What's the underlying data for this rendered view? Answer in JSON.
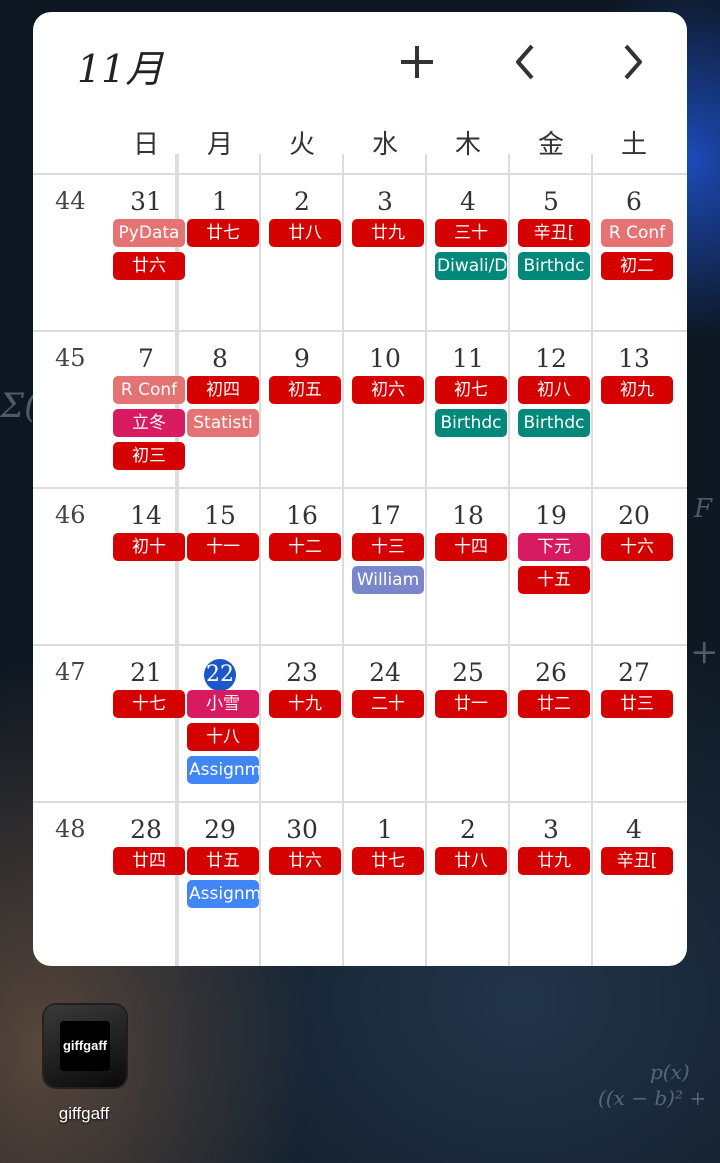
{
  "header": {
    "month": "11月"
  },
  "icons": {
    "add": "plus-icon",
    "prev": "chevron-left-icon",
    "next": "chevron-right-icon"
  },
  "colors": {
    "holiday_red": "#d50000",
    "solar_term_pink": "#d81b60",
    "salmon": "#e57373",
    "teal": "#00897b",
    "lavender": "#7986cb",
    "blue": "#4285f4",
    "today": "#1a57c8"
  },
  "weekdays": [
    "日",
    "月",
    "火",
    "水",
    "木",
    "金",
    "土"
  ],
  "weeks": [
    {
      "num": "44",
      "days": [
        {
          "d": "31",
          "chips": [
            {
              "t": "PyData",
              "c": "#e57373"
            },
            {
              "t": "廿六",
              "c": "#d50000"
            }
          ]
        },
        {
          "d": "1",
          "chips": [
            {
              "t": "廿七",
              "c": "#d50000"
            }
          ]
        },
        {
          "d": "2",
          "chips": [
            {
              "t": "廿八",
              "c": "#d50000"
            }
          ]
        },
        {
          "d": "3",
          "chips": [
            {
              "t": "廿九",
              "c": "#d50000"
            }
          ]
        },
        {
          "d": "4",
          "chips": [
            {
              "t": "三十",
              "c": "#d50000"
            },
            {
              "t": "Diwali/D",
              "c": "#00897b"
            }
          ]
        },
        {
          "d": "5",
          "chips": [
            {
              "t": "辛丑[",
              "c": "#d50000"
            },
            {
              "t": "Birthdc",
              "c": "#00897b"
            }
          ]
        },
        {
          "d": "6",
          "chips": [
            {
              "t": "R Conf",
              "c": "#e57373"
            },
            {
              "t": "初二",
              "c": "#d50000"
            }
          ]
        }
      ]
    },
    {
      "num": "45",
      "days": [
        {
          "d": "7",
          "chips": [
            {
              "t": "R Conf",
              "c": "#e57373"
            },
            {
              "t": "立冬",
              "c": "#d81b60"
            },
            {
              "t": "初三",
              "c": "#d50000"
            }
          ]
        },
        {
          "d": "8",
          "chips": [
            {
              "t": "初四",
              "c": "#d50000"
            },
            {
              "t": "Statisti",
              "c": "#e57373"
            }
          ]
        },
        {
          "d": "9",
          "chips": [
            {
              "t": "初五",
              "c": "#d50000"
            }
          ]
        },
        {
          "d": "10",
          "chips": [
            {
              "t": "初六",
              "c": "#d50000"
            }
          ]
        },
        {
          "d": "11",
          "chips": [
            {
              "t": "初七",
              "c": "#d50000"
            },
            {
              "t": "Birthdc",
              "c": "#00897b"
            }
          ]
        },
        {
          "d": "12",
          "chips": [
            {
              "t": "初八",
              "c": "#d50000"
            },
            {
              "t": "Birthdc",
              "c": "#00897b"
            }
          ]
        },
        {
          "d": "13",
          "chips": [
            {
              "t": "初九",
              "c": "#d50000"
            }
          ]
        }
      ]
    },
    {
      "num": "46",
      "days": [
        {
          "d": "14",
          "chips": [
            {
              "t": "初十",
              "c": "#d50000"
            }
          ]
        },
        {
          "d": "15",
          "chips": [
            {
              "t": "十一",
              "c": "#d50000"
            }
          ]
        },
        {
          "d": "16",
          "chips": [
            {
              "t": "十二",
              "c": "#d50000"
            }
          ]
        },
        {
          "d": "17",
          "chips": [
            {
              "t": "十三",
              "c": "#d50000"
            },
            {
              "t": "William",
              "c": "#7986cb"
            }
          ]
        },
        {
          "d": "18",
          "chips": [
            {
              "t": "十四",
              "c": "#d50000"
            }
          ]
        },
        {
          "d": "19",
          "chips": [
            {
              "t": "下元",
              "c": "#d81b60"
            },
            {
              "t": "十五",
              "c": "#d50000"
            }
          ]
        },
        {
          "d": "20",
          "chips": [
            {
              "t": "十六",
              "c": "#d50000"
            }
          ]
        }
      ]
    },
    {
      "num": "47",
      "days": [
        {
          "d": "21",
          "chips": [
            {
              "t": "十七",
              "c": "#d50000"
            }
          ]
        },
        {
          "d": "22",
          "today": true,
          "chips": [
            {
              "t": "小雪",
              "c": "#d81b60"
            },
            {
              "t": "十八",
              "c": "#d50000"
            },
            {
              "t": "Assignm",
              "c": "#4285f4"
            }
          ]
        },
        {
          "d": "23",
          "chips": [
            {
              "t": "十九",
              "c": "#d50000"
            }
          ]
        },
        {
          "d": "24",
          "chips": [
            {
              "t": "二十",
              "c": "#d50000"
            }
          ]
        },
        {
          "d": "25",
          "chips": [
            {
              "t": "廿一",
              "c": "#d50000"
            }
          ]
        },
        {
          "d": "26",
          "chips": [
            {
              "t": "廿二",
              "c": "#d50000"
            }
          ]
        },
        {
          "d": "27",
          "chips": [
            {
              "t": "廿三",
              "c": "#d50000"
            }
          ]
        }
      ]
    },
    {
      "num": "48",
      "days": [
        {
          "d": "28",
          "chips": [
            {
              "t": "廿四",
              "c": "#d50000"
            }
          ]
        },
        {
          "d": "29",
          "chips": [
            {
              "t": "廿五",
              "c": "#d50000"
            },
            {
              "t": "Assignm",
              "c": "#4285f4"
            }
          ]
        },
        {
          "d": "30",
          "chips": [
            {
              "t": "廿六",
              "c": "#d50000"
            }
          ]
        },
        {
          "d": "1",
          "chips": [
            {
              "t": "廿七",
              "c": "#d50000"
            }
          ]
        },
        {
          "d": "2",
          "chips": [
            {
              "t": "廿八",
              "c": "#d50000"
            }
          ]
        },
        {
          "d": "3",
          "chips": [
            {
              "t": "廿九",
              "c": "#d50000"
            }
          ]
        },
        {
          "d": "4",
          "chips": [
            {
              "t": "辛丑[",
              "c": "#d50000"
            }
          ]
        }
      ]
    }
  ],
  "app": {
    "icon_text": "giffgaff",
    "label": "giffgaff"
  }
}
